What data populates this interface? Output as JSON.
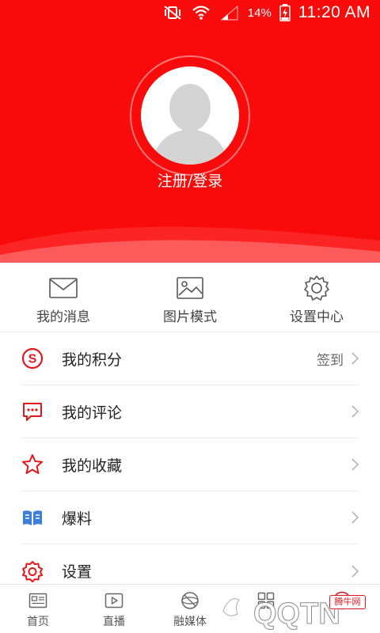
{
  "status_bar": {
    "battery_percent": "14%",
    "time": "11:20 AM",
    "icons": [
      "vibrate-mute-icon",
      "wifi-icon",
      "signal-icon",
      "battery-charging-icon"
    ]
  },
  "profile": {
    "login_label": "注册/登录"
  },
  "quick_actions": [
    {
      "label": "我的消息",
      "icon": "envelope-icon"
    },
    {
      "label": "图片模式",
      "icon": "image-icon"
    },
    {
      "label": "设置中心",
      "icon": "gear-icon"
    }
  ],
  "menu": [
    {
      "label": "我的积分",
      "icon": "points-s-icon",
      "right_text": "签到"
    },
    {
      "label": "我的评论",
      "icon": "comment-icon",
      "right_text": ""
    },
    {
      "label": "我的收藏",
      "icon": "star-icon",
      "right_text": ""
    },
    {
      "label": "爆料",
      "icon": "book-icon",
      "right_text": ""
    },
    {
      "label": "设置",
      "icon": "settings-icon",
      "right_text": ""
    }
  ],
  "bottom_nav": [
    {
      "label": "首页",
      "icon": "news-icon"
    },
    {
      "label": "直播",
      "icon": "play-icon"
    },
    {
      "label": "融媒体",
      "icon": "globe-icon"
    },
    {
      "label": "",
      "icon": "grid-icon"
    },
    {
      "label": "",
      "icon": "user-icon",
      "active": true
    }
  ],
  "watermark": {
    "badge": "腾牛网",
    "text": "QQTN"
  },
  "colors": {
    "brand_red": "#f90b0b",
    "accent_red": "#e4161b",
    "book_blue": "#3b7fd9"
  }
}
